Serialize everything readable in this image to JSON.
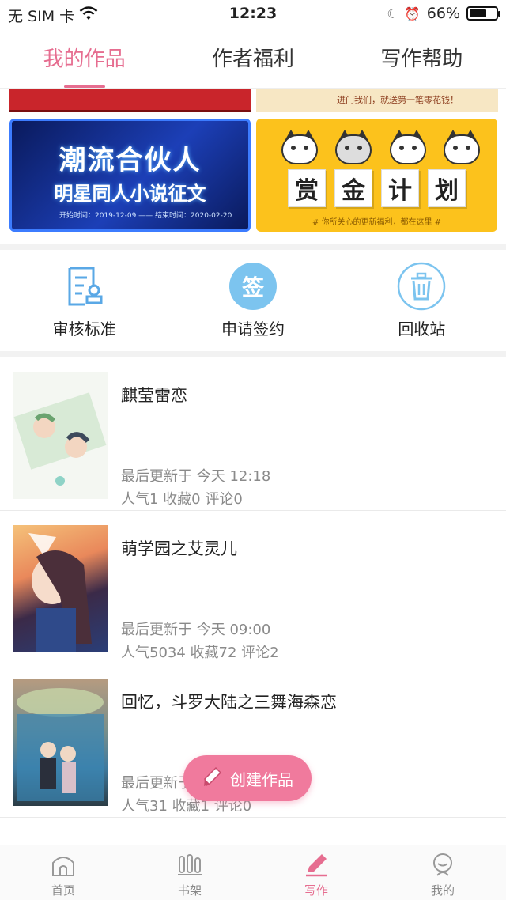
{
  "status_bar": {
    "carrier": "无 SIM 卡",
    "time": "12:23",
    "battery": "66%",
    "battery_level": 0.66
  },
  "tabs": [
    {
      "label": "我的作品",
      "active": true
    },
    {
      "label": "作者福利",
      "active": false
    },
    {
      "label": "写作帮助",
      "active": false
    }
  ],
  "banners": {
    "top_right_text": "进门我们，就送第一笔零花钱！",
    "campaign": {
      "line1": "潮流合伙人",
      "line2": "明星同人小说征文",
      "dates": "开始时间：2019-12-09 —— 结束时间：2020-02-20"
    },
    "reward": {
      "chars": [
        "赏",
        "金",
        "计",
        "划"
      ],
      "note": "# 你所关心的更新福利，都在这里 #"
    }
  },
  "actions": [
    {
      "label": "审核标准",
      "icon": "review-standard-icon"
    },
    {
      "label": "申请签约",
      "icon": "sign-contract-icon",
      "glyph": "签"
    },
    {
      "label": "回收站",
      "icon": "trash-icon"
    }
  ],
  "works": [
    {
      "title": "麒莹雷恋",
      "updated": "最后更新于 今天 12:18",
      "stats": "人气1 收藏0 评论0"
    },
    {
      "title": "萌学园之艾灵儿",
      "updated": "最后更新于 今天 09:00",
      "stats": "人气5034 收藏72 评论2"
    },
    {
      "title": "回忆，斗罗大陆之三舞海森恋",
      "updated": "最后更新于 今天",
      "stats": "人气31 收藏1 评论0"
    }
  ],
  "fab": {
    "label": "创建作品"
  },
  "bottom_nav": [
    {
      "label": "首页",
      "icon": "home-icon",
      "active": false
    },
    {
      "label": "书架",
      "icon": "bookshelf-icon",
      "active": false
    },
    {
      "label": "写作",
      "icon": "pen-icon",
      "active": true
    },
    {
      "label": "我的",
      "icon": "profile-icon",
      "active": false
    }
  ],
  "colors": {
    "accent": "#e66d90",
    "fab": "#f07a9d",
    "action_blue": "#7cc4ef"
  }
}
